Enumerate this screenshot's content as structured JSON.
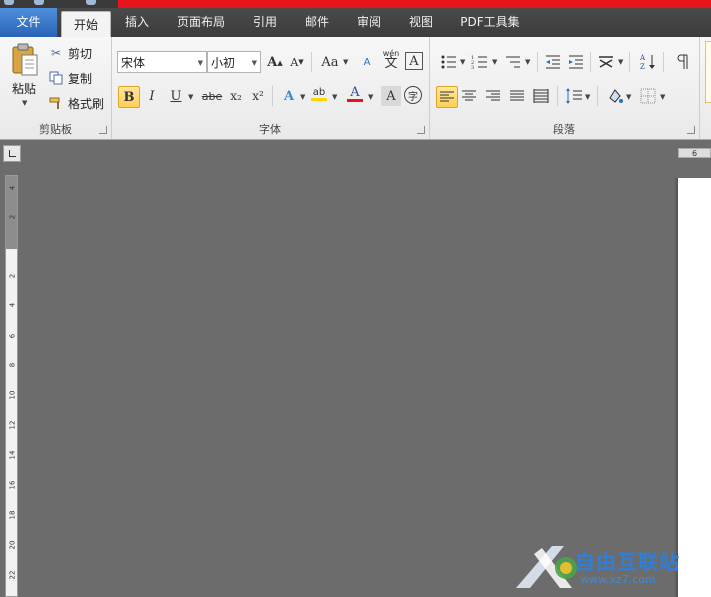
{
  "tabs": {
    "file": "文件",
    "home": "开始",
    "insert": "插入",
    "page_layout": "页面布局",
    "references": "引用",
    "mailings": "邮件",
    "review": "审阅",
    "view": "视图",
    "pdf_tools": "PDF工具集"
  },
  "clipboard": {
    "paste": "粘贴",
    "cut": "剪切",
    "copy": "复制",
    "format_painter": "格式刷",
    "group_label": "剪贴板"
  },
  "font": {
    "font_name": "宋体",
    "font_size": "小初",
    "group_label": "字体",
    "grow_label": "A",
    "shrink_label": "A",
    "case_label": "Aa",
    "clear_label": "A",
    "phonetic_label": "wén",
    "phonetic_char": "文",
    "border_label": "A",
    "bold_label": "B",
    "italic_label": "I",
    "underline_label": "U",
    "strike_label": "abe",
    "subscript_label": "x₂",
    "superscript_label": "x²",
    "effects_label": "A",
    "highlight_label": "ab",
    "color_label": "A",
    "shading_label": "A",
    "enclose_label": "字",
    "color_accent": "#e8141c",
    "highlight_accent": "#ffd700"
  },
  "paragraph": {
    "group_label": "段落"
  },
  "ruler": {
    "h_number": "6",
    "v_numbers": [
      "4",
      "2",
      "2",
      "4",
      "6",
      "8",
      "10",
      "12",
      "14",
      "16",
      "18",
      "20",
      "22"
    ]
  },
  "watermark": {
    "text": "自由互联站",
    "url": "www.xz7.com"
  },
  "colors": {
    "accent_red": "#e8141c",
    "file_tab_blue": "#2a63b6",
    "workspace_gray": "#6c6c6c"
  }
}
